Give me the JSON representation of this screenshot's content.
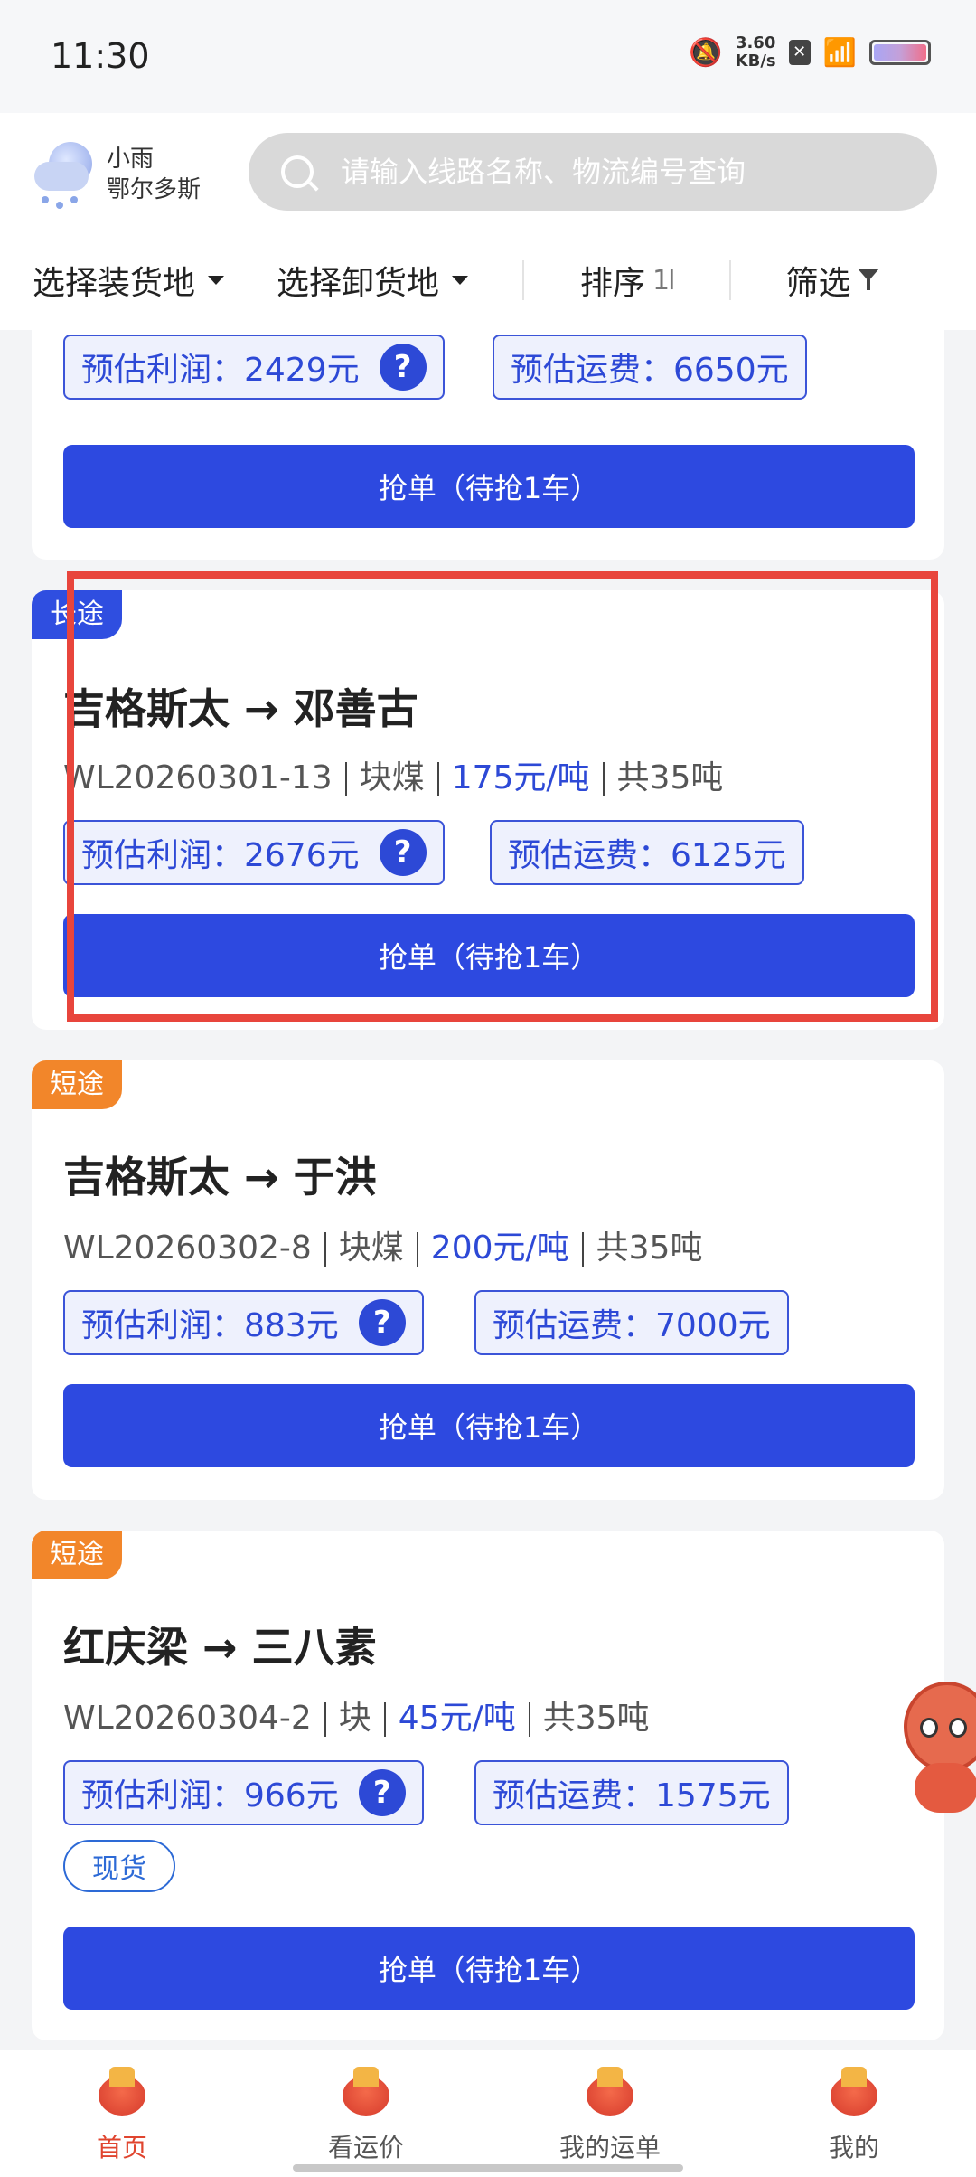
{
  "status_bar": {
    "time": "11:30",
    "net_speed_value": "3.60",
    "net_speed_unit": "KB/s"
  },
  "header": {
    "weather_condition": "小雨",
    "city": "鄂尔多斯",
    "search_placeholder": "请输入线路名称、物流编号查询"
  },
  "filters": {
    "load_place": "选择装货地",
    "unload_place": "选择卸货地",
    "sort": "排序",
    "sort_icon": "1l",
    "filter": "筛选"
  },
  "colors": {
    "accent": "#2d49e0",
    "tag_long": "#2f4ee0",
    "tag_short": "#f2862a",
    "highlight": "#e8453c"
  },
  "partial_card": {
    "profit": "预估利润：2429元",
    "fee": "预估运费：6650元",
    "grab_label": "抢单（待抢1车）"
  },
  "cards": [
    {
      "tag": "长途",
      "route": "吉格斯太 → 邓善古",
      "id": "WL20260301-13",
      "cargo": "块煤",
      "price": "175元/吨",
      "total": "共35吨",
      "profit": "预估利润：2676元",
      "fee": "预估运费：6125元",
      "grab_label": "抢单（待抢1车）"
    },
    {
      "tag": "短途",
      "route": "吉格斯太 → 于洪",
      "id": "WL20260302-8",
      "cargo": "块煤",
      "price": "200元/吨",
      "total": "共35吨",
      "profit": "预估利润：883元",
      "fee": "预估运费：7000元",
      "grab_label": "抢单（待抢1车）"
    },
    {
      "tag": "短途",
      "route": "红庆梁 → 三八素",
      "id": "WL20260304-2",
      "cargo": "块",
      "price": "45元/吨",
      "total": "共35吨",
      "profit": "预估利润：966元",
      "fee": "预估运费：1575元",
      "extra_tag": "现货",
      "grab_label": "抢单（待抢1车）"
    }
  ],
  "bottom_nav": {
    "items": [
      {
        "label": "首页",
        "icon": "home-icon"
      },
      {
        "label": "看运价",
        "icon": "freight-price-icon"
      },
      {
        "label": "我的运单",
        "icon": "waybill-icon"
      },
      {
        "label": "我的",
        "icon": "profile-icon"
      }
    ]
  }
}
